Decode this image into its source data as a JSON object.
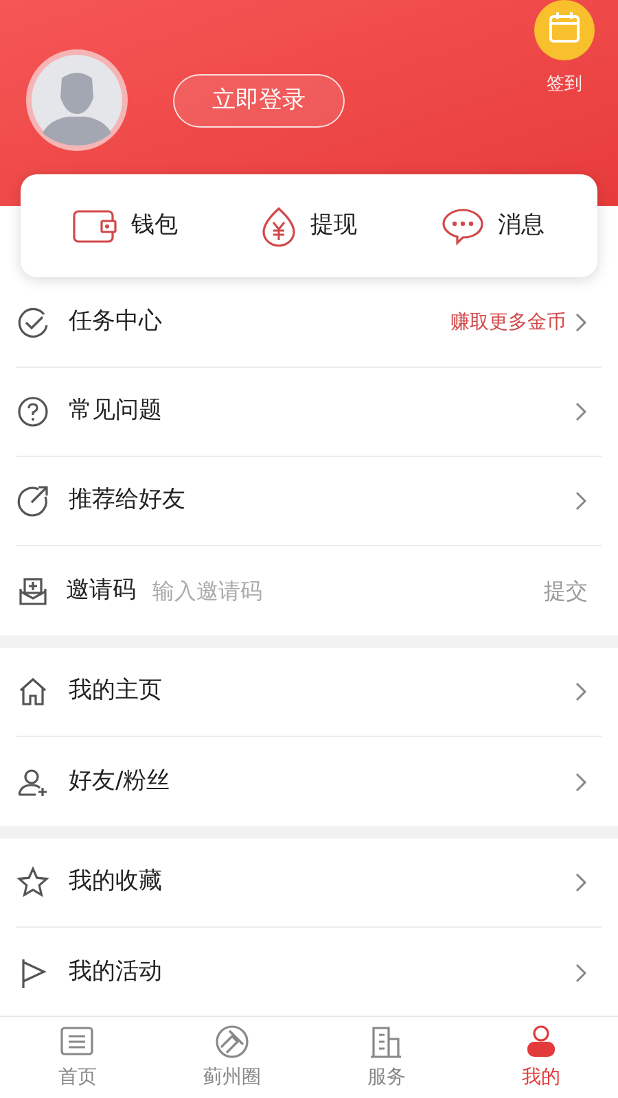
{
  "header": {
    "login_button": "立即登录",
    "checkin_label": "签到"
  },
  "quick_actions": [
    {
      "label": "钱包"
    },
    {
      "label": "提现"
    },
    {
      "label": "消息"
    }
  ],
  "sections": [
    {
      "rows": [
        {
          "kind": "link",
          "label": "任务中心",
          "hint": "赚取更多金币"
        },
        {
          "kind": "link",
          "label": "常见问题"
        },
        {
          "kind": "link",
          "label": "推荐给好友"
        },
        {
          "kind": "invite",
          "label": "邀请码",
          "placeholder": "输入邀请码",
          "action": "提交"
        }
      ]
    },
    {
      "rows": [
        {
          "kind": "link",
          "label": "我的主页"
        },
        {
          "kind": "link",
          "label": "好友/粉丝"
        }
      ]
    },
    {
      "rows": [
        {
          "kind": "link",
          "label": "我的收藏"
        },
        {
          "kind": "link",
          "label": "我的活动"
        }
      ]
    }
  ],
  "tabs": [
    {
      "label": "首页",
      "selected": false
    },
    {
      "label": "蓟州圈",
      "selected": false
    },
    {
      "label": "服务",
      "selected": false
    },
    {
      "label": "我的",
      "selected": true
    }
  ]
}
